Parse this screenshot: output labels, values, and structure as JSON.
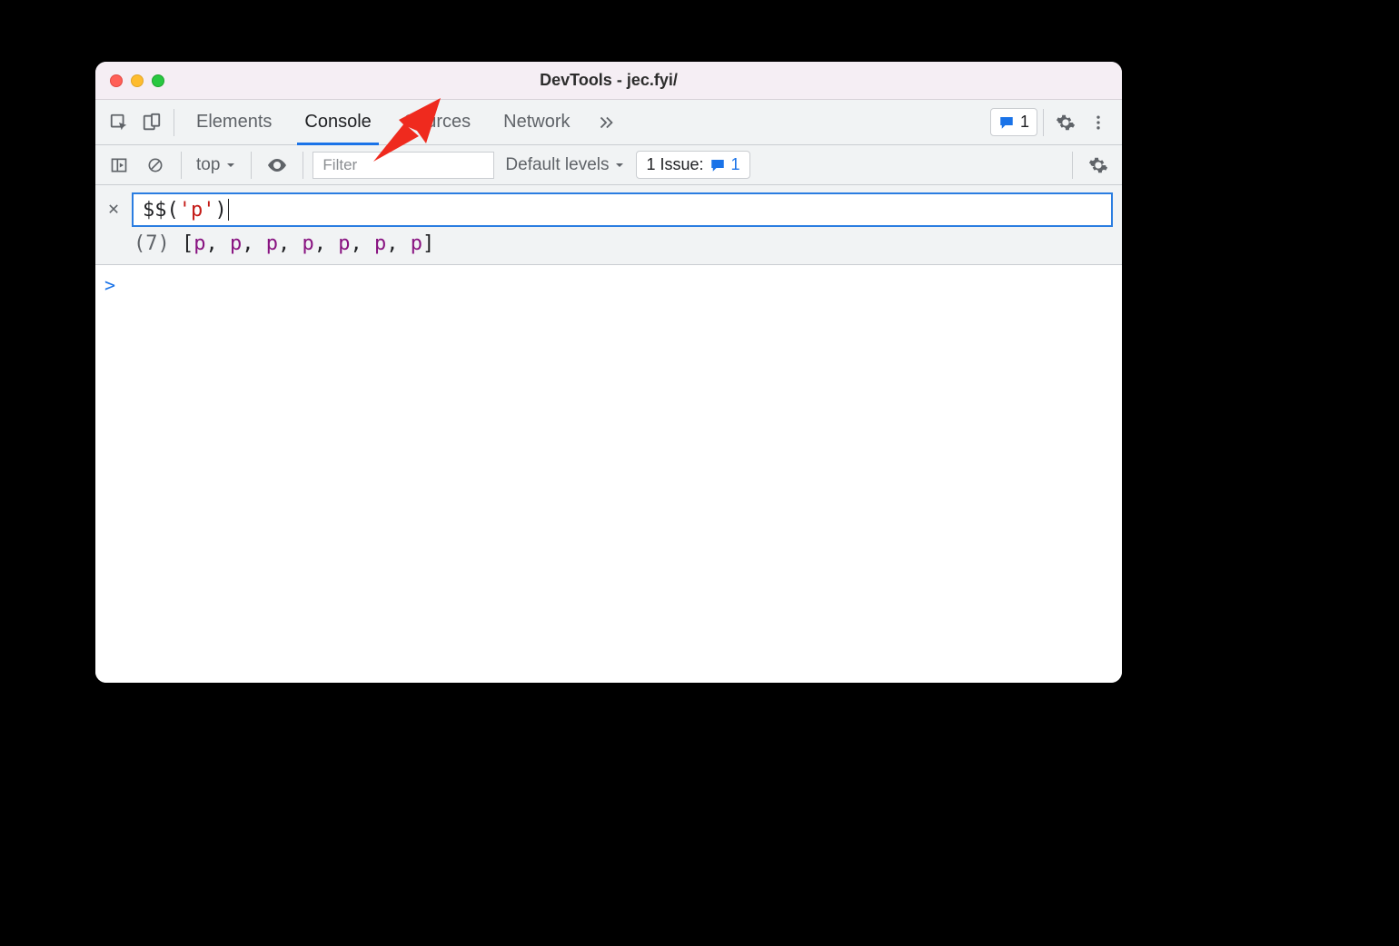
{
  "window": {
    "title": "DevTools - jec.fyi/"
  },
  "mainToolbar": {
    "tabs": [
      "Elements",
      "Console",
      "Sources",
      "Network"
    ],
    "activeTab": "Console",
    "messagesCount": "1"
  },
  "consoleToolbar": {
    "context": "top",
    "filterPlaceholder": "Filter",
    "levels": "Default levels",
    "issuesLabel": "1 Issue:",
    "issuesCount": "1"
  },
  "eagerEval": {
    "fn": "$$",
    "openParen": "(",
    "string": "'p'",
    "closeParen": ")",
    "previewCount": "(7)",
    "previewOpen": "[",
    "previewItems": [
      "p",
      "p",
      "p",
      "p",
      "p",
      "p",
      "p"
    ],
    "previewClose": "]"
  },
  "prompt": ">"
}
